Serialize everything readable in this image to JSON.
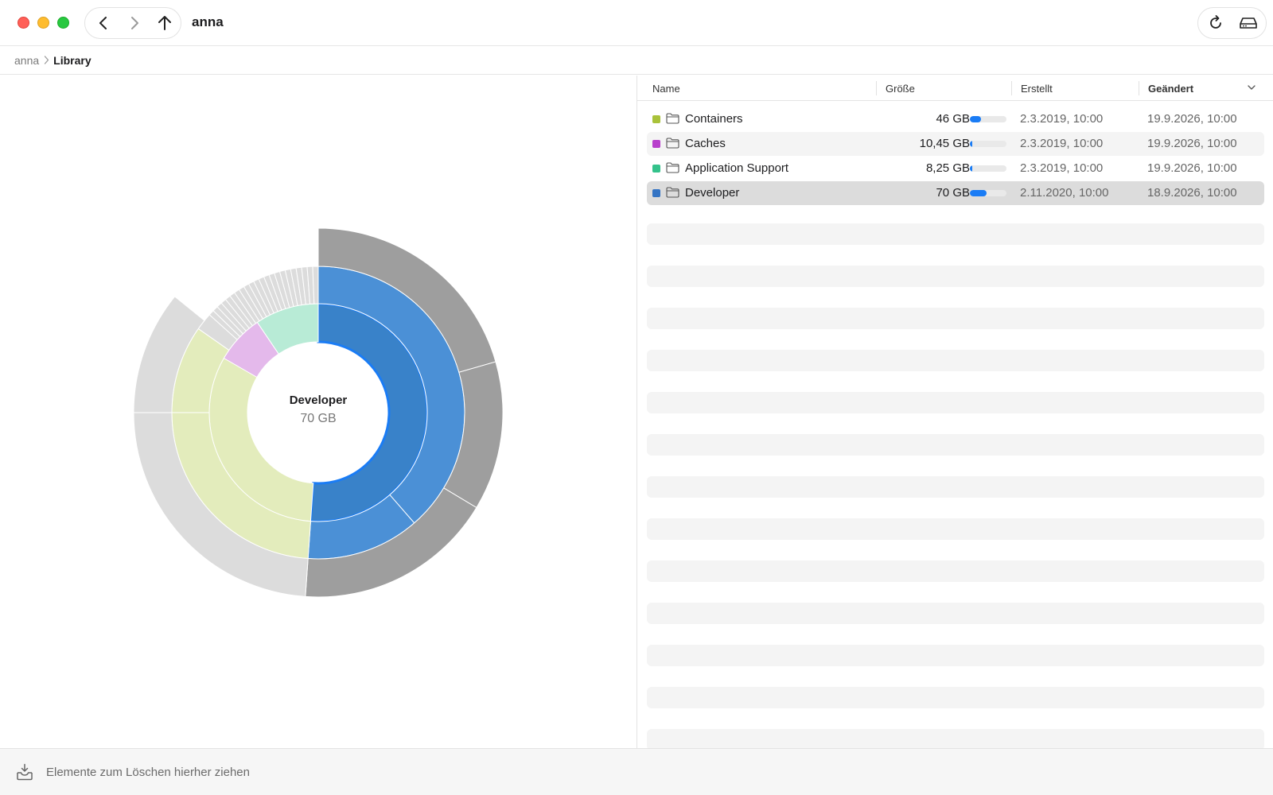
{
  "window": {
    "title": "anna"
  },
  "toolbar": {
    "back_icon": "chevron-left-icon",
    "forward_icon": "chevron-right-icon",
    "up_icon": "arrow-up-icon",
    "refresh_icon": "refresh-icon",
    "disk_icon": "disk-icon"
  },
  "breadcrumb": {
    "items": [
      "anna",
      "Library"
    ]
  },
  "chart": {
    "center_name": "Developer",
    "center_size": "70 GB",
    "colors": {
      "developer": "#4b90d6",
      "developer_selected": "#3982c9",
      "developer_outline": "#1a7cf5",
      "containers": "#e3ecbc",
      "caches": "#e4b9eb",
      "application_support": "#b8ebd6",
      "outer_developer": "#9e9e9e",
      "outer_other": "#dcdcdc"
    }
  },
  "list": {
    "columns": {
      "name": "Name",
      "size": "Größe",
      "created": "Erstellt",
      "modified": "Geändert"
    },
    "rows": [
      {
        "color": "#a9c23a",
        "name": "Containers",
        "size": "46 GB",
        "fraction": 0.3,
        "created": "2.3.2019, 10:00",
        "modified": "19.9.2026, 10:00"
      },
      {
        "color": "#b83fcc",
        "name": "Caches",
        "size": "10,45 GB",
        "fraction": 0.07,
        "created": "2.3.2019, 10:00",
        "modified": "19.9.2026, 10:00"
      },
      {
        "color": "#34c28b",
        "name": "Application Support",
        "size": "8,25 GB",
        "fraction": 0.06,
        "created": "2.3.2019, 10:00",
        "modified": "19.9.2026, 10:00"
      },
      {
        "color": "#3474c4",
        "name": "Developer",
        "size": "70 GB",
        "fraction": 0.46,
        "created": "2.11.2020, 10:00",
        "modified": "18.9.2026, 10:00"
      }
    ],
    "selected_row": "Developer"
  },
  "footer": {
    "text": "Elemente zum Löschen hierher ziehen",
    "icon": "tray-download-icon"
  }
}
